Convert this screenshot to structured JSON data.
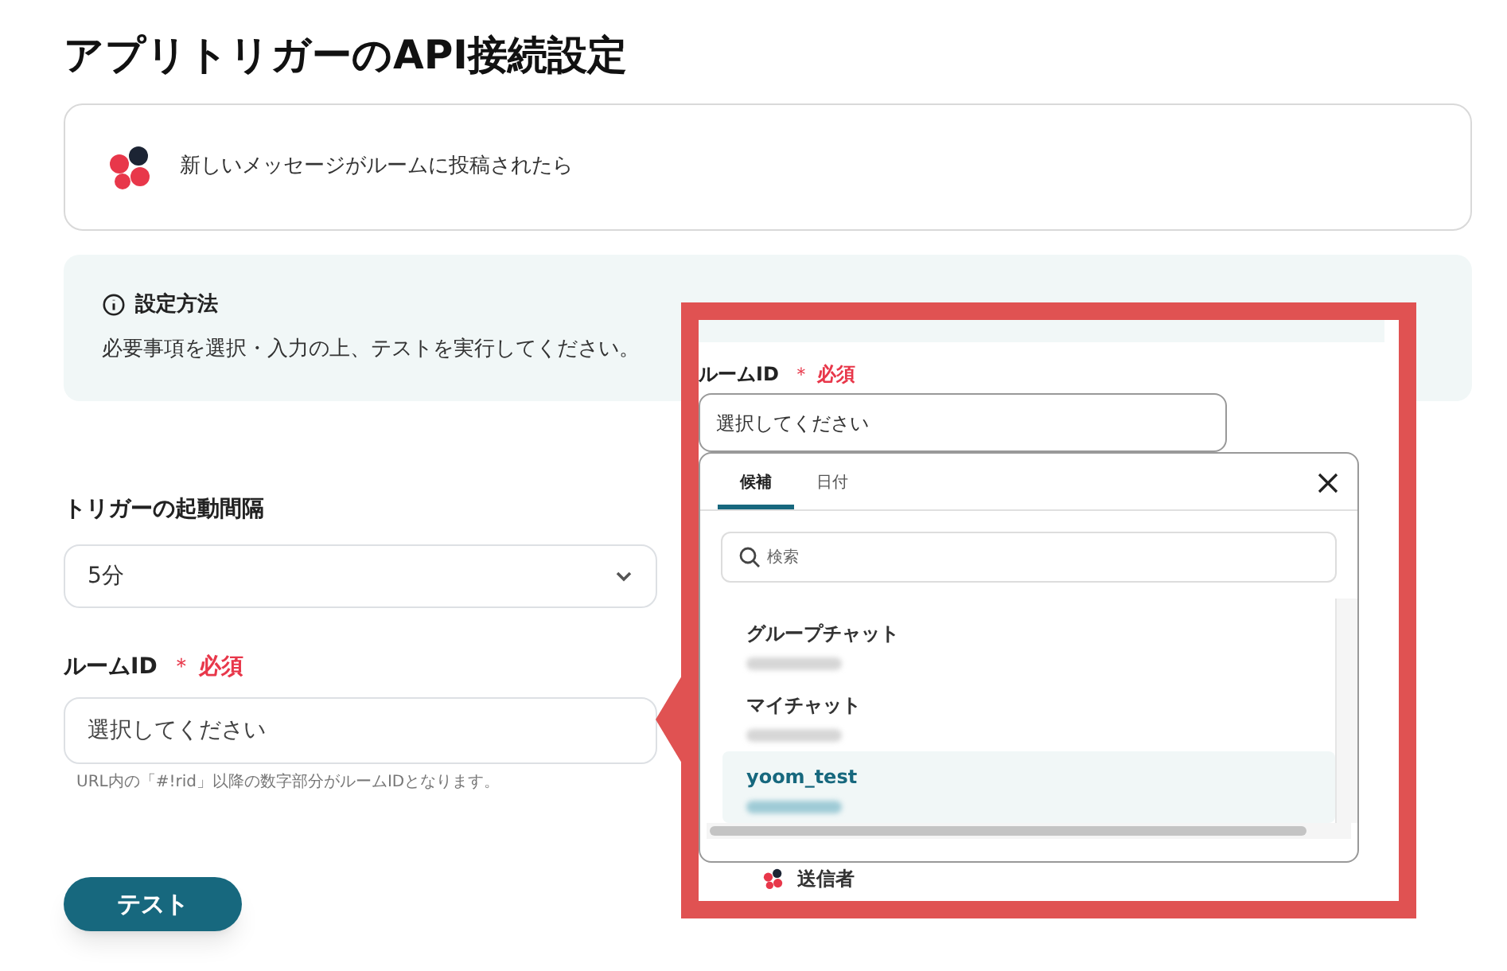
{
  "page_title": "アプリトリガーのAPI接続設定",
  "trigger_card": {
    "text": "新しいメッセージがルームに投稿されたら"
  },
  "info_box": {
    "heading": "設定方法",
    "text": "必要事項を選択・入力の上、テストを実行してください。"
  },
  "fields": [
    {
      "kind": "select",
      "label": "トリガーの起動間隔",
      "value": "5分"
    },
    {
      "kind": "input",
      "label": "ルームID",
      "required_mark": "＊",
      "required_text": "必須",
      "placeholder": "選択してください",
      "help": "URL内の「#!rid」以降の数字部分がルームIDとなります。"
    }
  ],
  "test_button": "テスト",
  "callout": {
    "label": "ルームID",
    "required_mark": "＊",
    "required_text": "必須",
    "placeholder": "選択してください",
    "tabs": [
      {
        "label": "候補",
        "selected": true
      },
      {
        "label": "日付",
        "selected": false
      }
    ],
    "search_placeholder": "検索",
    "options": [
      {
        "name": "グループチャット",
        "selected": false
      },
      {
        "name": "マイチャット",
        "selected": false
      },
      {
        "name": "yoom_test",
        "selected": true
      }
    ],
    "below_item": "送信者"
  }
}
